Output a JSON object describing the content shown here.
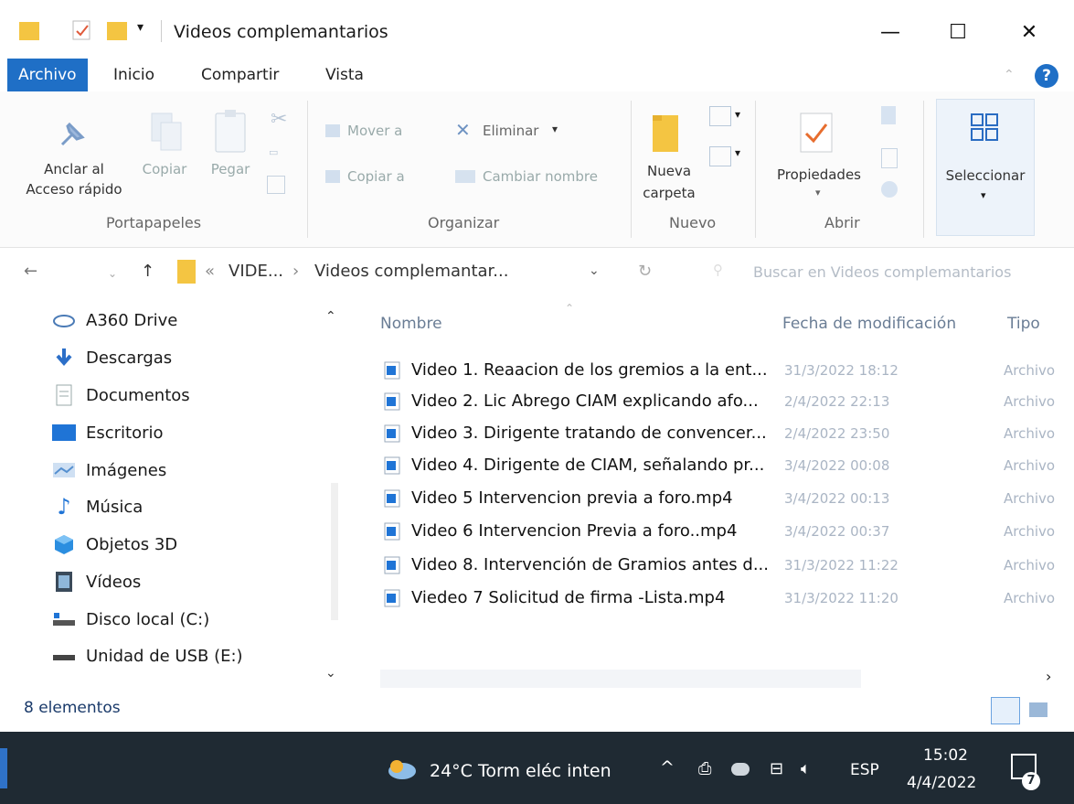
{
  "window": {
    "title": "Videos complemantarios",
    "minimize_glyph": "—",
    "maximize_glyph": "☐",
    "close_glyph": "✕"
  },
  "tabs": [
    {
      "label": "Archivo",
      "active": true
    },
    {
      "label": "Inicio",
      "active": false
    },
    {
      "label": "Compartir",
      "active": false
    },
    {
      "label": "Vista",
      "active": false
    }
  ],
  "ribbon": {
    "pin_label_1": "Anclar al",
    "pin_label_2": "Acceso rápido",
    "copy_label": "Copiar",
    "paste_label": "Pegar",
    "group_portapapeles": "Portapapeles",
    "move_label": "Mover a",
    "copyto_label": "Copiar a",
    "delete_label": "Eliminar",
    "rename_label": "Cambiar nombre",
    "group_organizar": "Organizar",
    "newfolder_label_1": "Nueva",
    "newfolder_label_2": "carpeta",
    "group_nuevo": "Nuevo",
    "properties_label": "Propiedades",
    "group_abrir": "Abrir",
    "select_label": "Seleccionar"
  },
  "address": {
    "path_prefix": "«",
    "path_parent": "VIDE...",
    "path_sep": "›",
    "path_current": "Videos complemantar...",
    "search_placeholder": "Buscar en Videos complemantarios"
  },
  "nav": {
    "items": [
      {
        "label": "A360 Drive",
        "icon": "cloud-drive-icon"
      },
      {
        "label": "Descargas",
        "icon": "download-icon"
      },
      {
        "label": "Documentos",
        "icon": "document-icon"
      },
      {
        "label": "Escritorio",
        "icon": "desktop-icon"
      },
      {
        "label": "Imágenes",
        "icon": "pictures-icon"
      },
      {
        "label": "Música",
        "icon": "music-icon"
      },
      {
        "label": "Objetos 3D",
        "icon": "objects3d-icon"
      },
      {
        "label": "Vídeos",
        "icon": "videos-icon"
      },
      {
        "label": "Disco local (C:)",
        "icon": "local-disk-icon"
      },
      {
        "label": "Unidad de USB (E:)",
        "icon": "usb-drive-icon"
      }
    ]
  },
  "list": {
    "col_name": "Nombre",
    "col_date": "Fecha de modificación",
    "col_type": "Tipo",
    "rows": [
      {
        "name": "Video 1. Reaacion de los gremios a la ent...",
        "date": "31/3/2022 18:12",
        "type": "Archivo"
      },
      {
        "name": "Video 2. Lic Abrego CIAM explicando afo...",
        "date": "2/4/2022 22:13",
        "type": "Archivo"
      },
      {
        "name": "Video 3. Dirigente tratando de convencer...",
        "date": "2/4/2022 23:50",
        "type": "Archivo"
      },
      {
        "name": "Video 4. Dirigente de CIAM, señalando pr...",
        "date": "3/4/2022 00:08",
        "type": "Archivo"
      },
      {
        "name": "Video 5 Intervencion previa a foro.mp4",
        "date": "3/4/2022 00:13",
        "type": "Archivo"
      },
      {
        "name": "Video 6 Intervencion Previa a foro..mp4",
        "date": "3/4/2022 00:37",
        "type": "Archivo"
      },
      {
        "name": "Video 8. Intervención de Gramios antes d...",
        "date": "31/3/2022 11:22",
        "type": "Archivo"
      },
      {
        "name": "Viedeo 7 Solicitud de firma -Lista.mp4",
        "date": "31/3/2022 11:20",
        "type": "Archivo"
      }
    ]
  },
  "status": {
    "count": "8 elementos"
  },
  "taskbar": {
    "weather": "24°C  Torm eléc inten",
    "language": "ESP",
    "time": "15:02",
    "date": "4/4/2022",
    "notif_count": "7"
  },
  "colors": {
    "accent": "#1f6fc6",
    "taskbar": "#1f2a33",
    "folder": "#f4c542"
  }
}
